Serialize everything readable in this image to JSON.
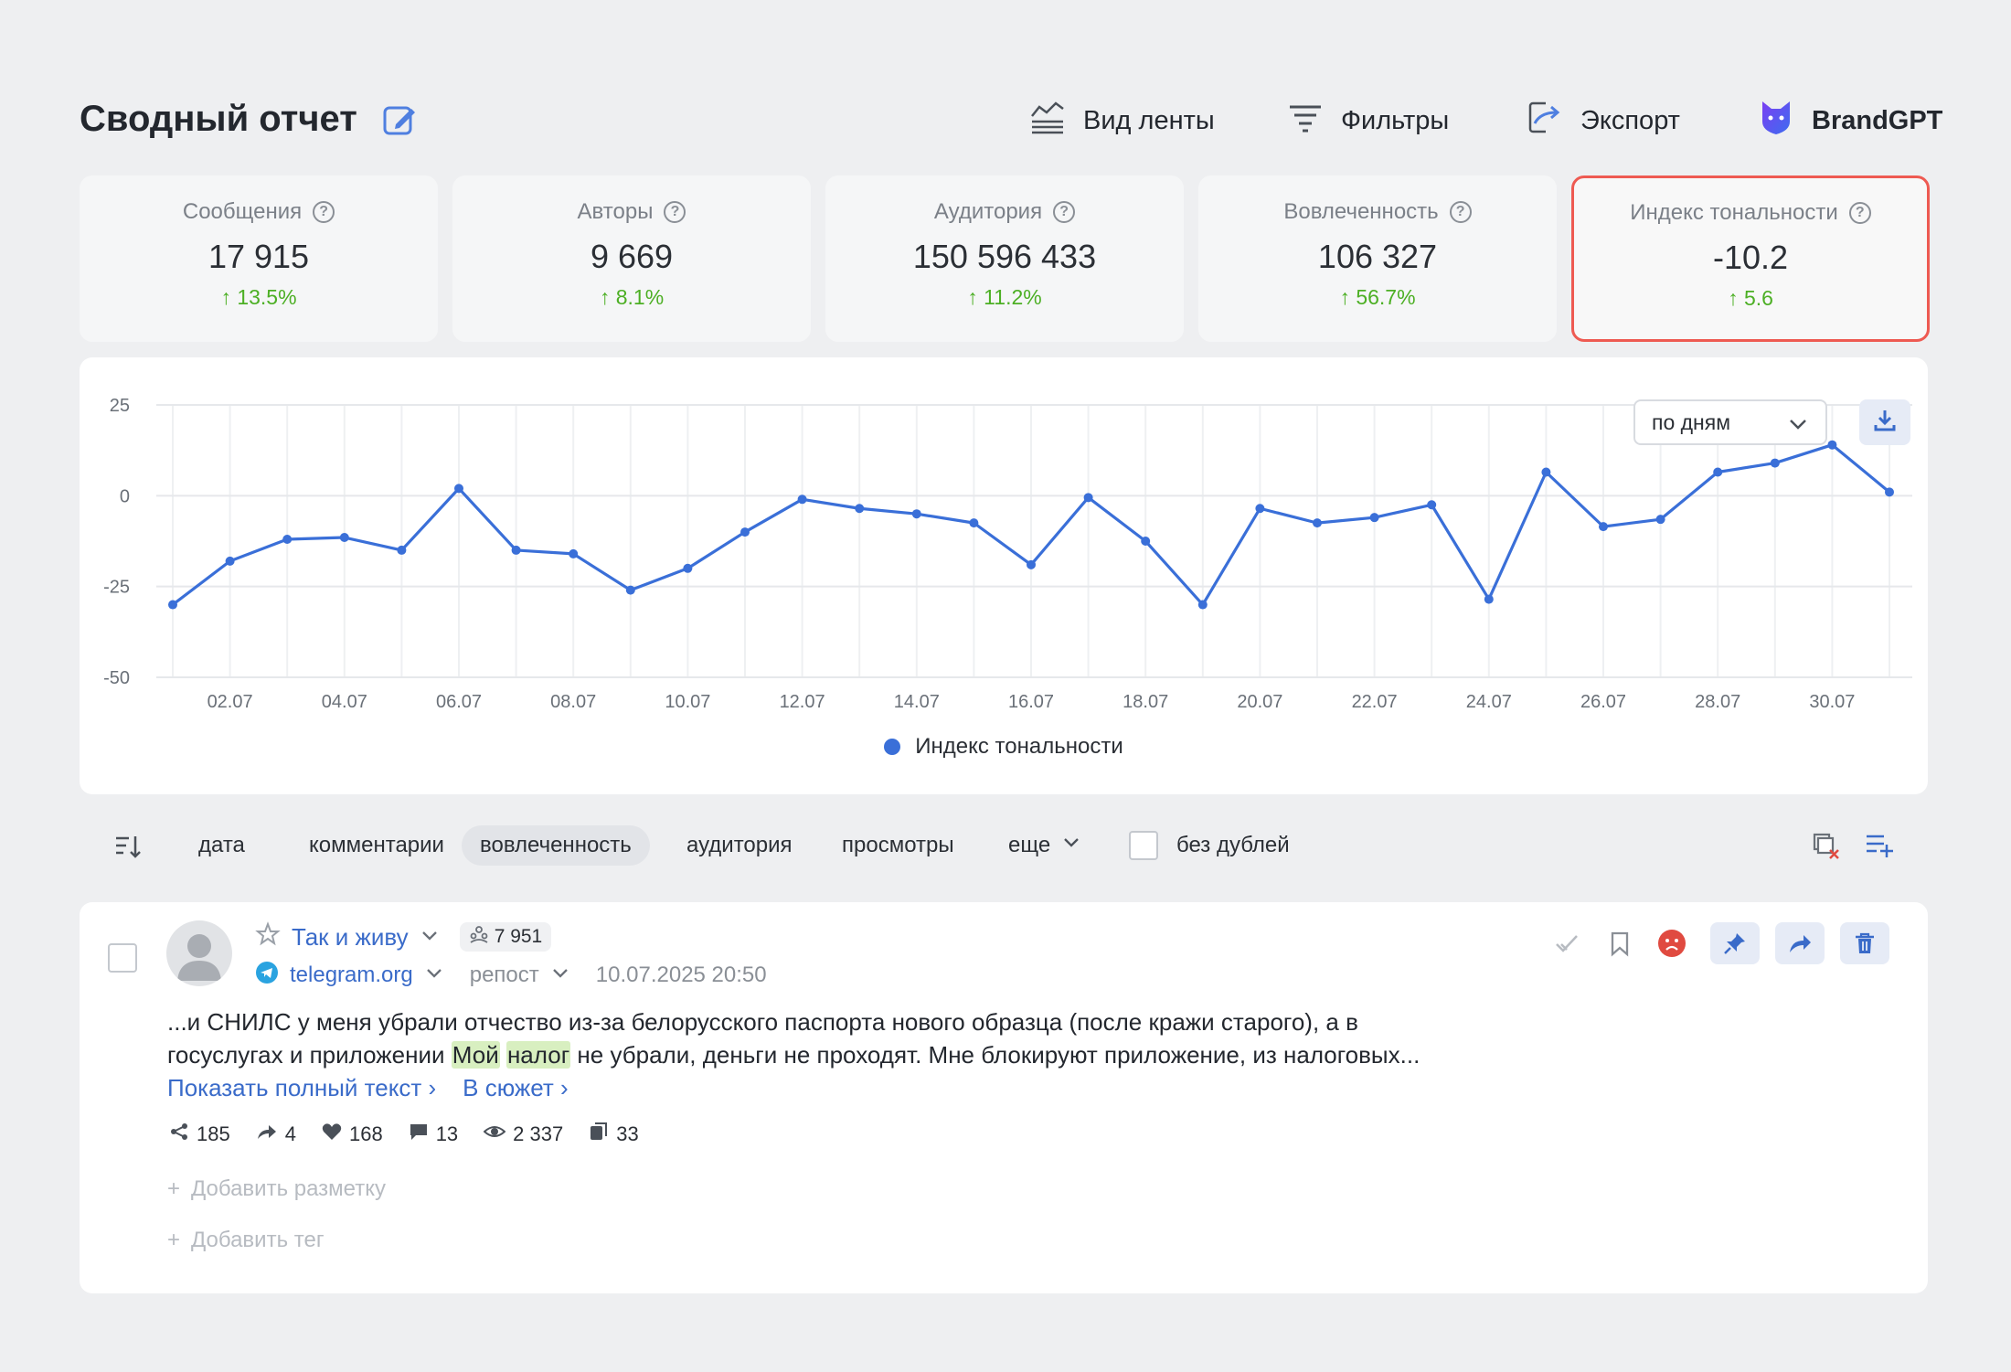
{
  "header": {
    "title": "Сводный отчет",
    "actions": [
      {
        "label": "Вид ленты",
        "icon": "feed-view-icon"
      },
      {
        "label": "Фильтры",
        "icon": "filter-icon"
      },
      {
        "label": "Экспорт",
        "icon": "export-icon"
      },
      {
        "label": "BrandGPT",
        "icon": "brandgpt-logo-icon"
      }
    ]
  },
  "stats": [
    {
      "label": "Сообщения",
      "value": "17 915",
      "delta": "↑ 13.5%"
    },
    {
      "label": "Авторы",
      "value": "9 669",
      "delta": "↑ 8.1%"
    },
    {
      "label": "Аудитория",
      "value": "150 596 433",
      "delta": "↑ 11.2%"
    },
    {
      "label": "Вовлеченность",
      "value": "106 327",
      "delta": "↑ 56.7%"
    },
    {
      "label": "Индекс тональности",
      "value": "-10.2",
      "delta": "↑ 5.6"
    }
  ],
  "colors": {
    "accent": "#3a6fd8",
    "positive": "#4caf24",
    "active_border": "#ee5a52",
    "link": "#3a6bc9"
  },
  "chart_controls": {
    "period": "по дням"
  },
  "chart_data": {
    "type": "line",
    "x": [
      "01.07",
      "02.07",
      "03.07",
      "04.07",
      "05.07",
      "06.07",
      "07.07",
      "08.07",
      "09.07",
      "10.07",
      "11.07",
      "12.07",
      "13.07",
      "14.07",
      "15.07",
      "16.07",
      "17.07",
      "18.07",
      "19.07",
      "20.07",
      "21.07",
      "22.07",
      "23.07",
      "24.07",
      "25.07",
      "26.07",
      "27.07",
      "28.07",
      "29.07",
      "30.07",
      "31.07"
    ],
    "series": [
      {
        "name": "Индекс тональности",
        "values": [
          -30,
          -18,
          -12,
          -11.5,
          -15,
          2,
          -15,
          -16,
          -26,
          -20,
          -10,
          -1,
          -3.5,
          -5,
          -7.5,
          -19,
          -0.5,
          -12.5,
          -30,
          -3.5,
          -7.5,
          -6,
          -2.5,
          -28.5,
          6.5,
          -8.5,
          -6.5,
          6.5,
          9,
          14,
          1
        ]
      }
    ],
    "xticks": [
      "02.07",
      "04.07",
      "06.07",
      "08.07",
      "10.07",
      "12.07",
      "14.07",
      "16.07",
      "18.07",
      "20.07",
      "22.07",
      "24.07",
      "26.07",
      "28.07",
      "30.07"
    ],
    "yticks": [
      25,
      0,
      -25,
      -50
    ],
    "ylim": [
      -50,
      25
    ],
    "grid": true,
    "legend": "bottom"
  },
  "sortbar": {
    "tabs": [
      "дата",
      "комментарии",
      "вовлеченность",
      "аудитория",
      "просмотры"
    ],
    "active": "вовлеченность",
    "more": "еще",
    "no_duplicates": "без дублей"
  },
  "post": {
    "author": "Так и живу",
    "audience": "7 951",
    "source": "telegram.org",
    "type": "репост",
    "date": "10.07.2025 20:50",
    "text_before": "...и СНИЛС у меня убрали отчество из-за белорусского паспорта нового образца (после кражи старого), а в госуслугах и приложении ",
    "highlight1": "Мой",
    "highlight2": "налог",
    "text_after": " не убрали, деньги не проходят. Мне блокируют приложение, из налоговых... ",
    "show_full": "Показать полный текст ›",
    "to_story": "В сюжет ›",
    "metrics": {
      "reposts": "185",
      "shares": "4",
      "likes": "168",
      "comments": "13",
      "views": "2 337",
      "copies": "33"
    },
    "add_markup": "Добавить разметку",
    "add_tag": "Добавить тег"
  }
}
